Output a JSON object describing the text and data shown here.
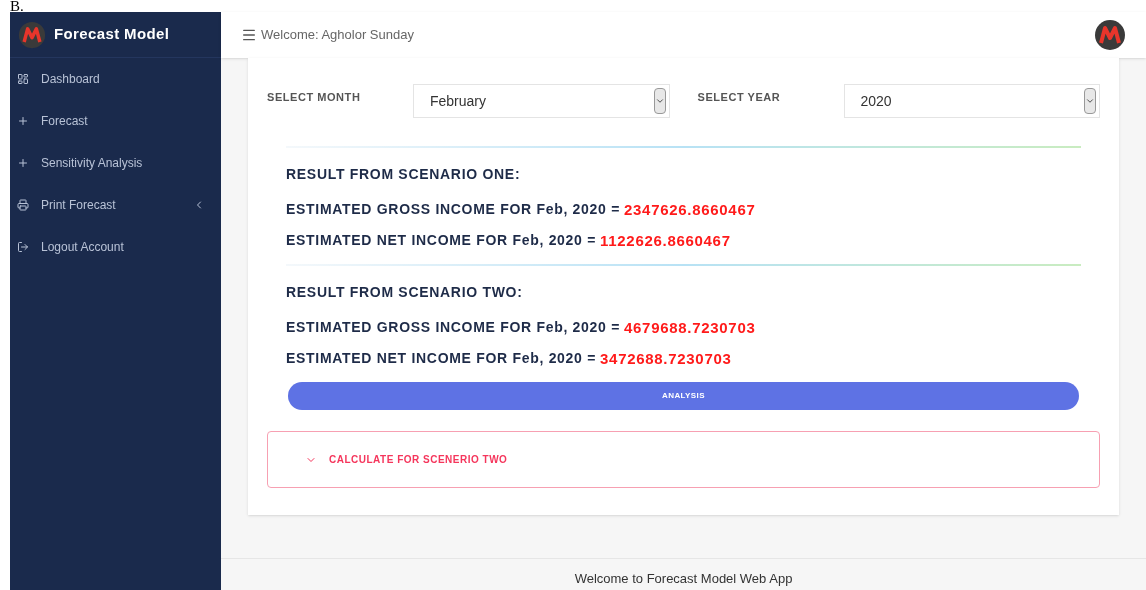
{
  "caption": "B.",
  "brand": {
    "title": "Forecast Model"
  },
  "sidebar": {
    "items": [
      {
        "label": "Dashboard",
        "kind": "dashboard",
        "has_submenu": false
      },
      {
        "label": "Forecast",
        "kind": "plus",
        "has_submenu": false
      },
      {
        "label": "Sensitivity Analysis",
        "kind": "plus",
        "has_submenu": false
      },
      {
        "label": "Print Forecast",
        "kind": "print",
        "has_submenu": true
      },
      {
        "label": "Logout Account",
        "kind": "logout",
        "has_submenu": false
      }
    ]
  },
  "header": {
    "welcome": "Welcome: Agholor Sunday"
  },
  "filters": [
    {
      "label": "SELECT MONTH",
      "value": "February"
    },
    {
      "label": "SELECT YEAR",
      "value": "2020"
    }
  ],
  "scenarios": [
    {
      "title": "RESULT FROM SCENARIO ONE:",
      "lines": [
        {
          "label": "ESTIMATED GROSS INCOME FOR Feb, 2020 =",
          "value": "2347626.8660467"
        },
        {
          "label": "ESTIMATED NET INCOME FOR Feb, 2020 =",
          "value": "1122626.8660467"
        }
      ]
    },
    {
      "title": "RESULT FROM SCENARIO TWO:",
      "lines": [
        {
          "label": "ESTIMATED GROSS INCOME FOR Feb, 2020 =",
          "value": "4679688.7230703"
        },
        {
          "label": "ESTIMATED NET INCOME FOR Feb, 2020 =",
          "value": "3472688.7230703"
        }
      ]
    }
  ],
  "analysis_button": "ANALYSIS",
  "accordion": {
    "label": "CALCULATE FOR SCENERIO TWO",
    "expanded": false
  },
  "footer": "Welcome to Forecast Model Web App"
}
